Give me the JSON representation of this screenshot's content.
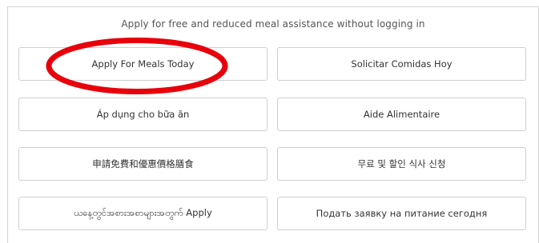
{
  "heading": "Apply for free and reduced meal assistance without logging in",
  "buttons": [
    {
      "label": "Apply For Meals Today"
    },
    {
      "label": "Solicitar Comidas Hoy"
    },
    {
      "label": "Áp dụng cho bữa ăn"
    },
    {
      "label": "Aide Alimentaire"
    },
    {
      "label": "申請免費和優惠價格膳食"
    },
    {
      "label": "무료 및 할인 식사 신청"
    },
    {
      "label": "ယနေ့တွင်အစားအစာများအတွက် Apply"
    },
    {
      "label": "Подать заявку на питание сегодня"
    }
  ],
  "annotation": {
    "color": "#e8000b"
  }
}
